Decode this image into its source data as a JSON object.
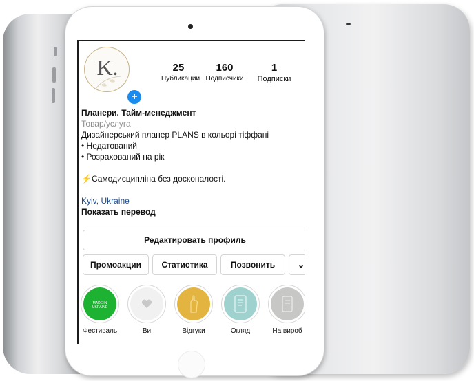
{
  "profile": {
    "avatar_letter": "K.",
    "stats": [
      {
        "value": "25",
        "label": "Публикации"
      },
      {
        "value": "160",
        "label": "Подписчики"
      },
      {
        "value": "1",
        "label": "Подписки"
      }
    ]
  },
  "bio": {
    "name": "Планери. Тайм-менеджмент",
    "category": "Товар/услуга",
    "lines": [
      "Дизайнерський планер PLANS в кольорі тіффані",
      "• Недатований",
      "• Розрахований на рік"
    ],
    "motto": "⚡Самодисципліна без досконалості.",
    "location": "Kyiv, Ukraine",
    "translate": "Показать перевод"
  },
  "buttons": {
    "edit_profile": "Редактировать профиль",
    "promotions": "Промоакции",
    "statistics": "Статистика",
    "call": "Позвонить",
    "more": "⌄"
  },
  "highlights": [
    {
      "label": "Фестиваль",
      "color": "#1db232",
      "badge": "MADE IN UKRAINE"
    },
    {
      "label": "Ви",
      "color": "#f1f1f1",
      "icon": "heart-icon"
    },
    {
      "label": "Відгуки",
      "color": "#e3b540",
      "icon": "hand-icon"
    },
    {
      "label": "Огляд",
      "color": "#9fd1cf",
      "icon": "planner-icon"
    },
    {
      "label": "На вироб",
      "color": "#c7c7c5",
      "icon": "planner-icon"
    }
  ]
}
